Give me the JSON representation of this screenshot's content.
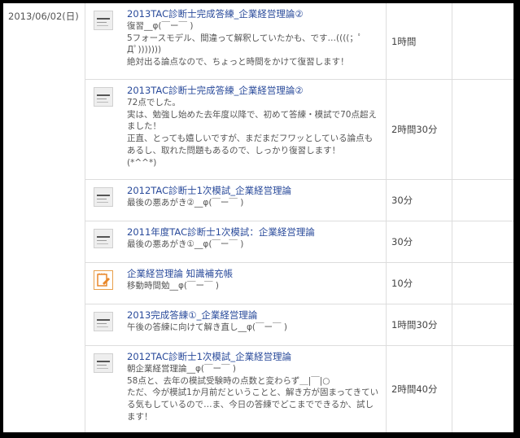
{
  "date": "2013/06/02(日)",
  "entries": [
    {
      "title": "2013TAC診断士完成答練_企業経営理論②",
      "description": "復習__φ(￣ー￣ )\n5フォースモデル、間違って解釈していたかも、です…((((；ﾟДﾟ)))))))\n絶対出る論点なので、ちょっと時間をかけて復習します！",
      "duration": "1時間",
      "icon": "document-thumbnail-icon"
    },
    {
      "title": "2013TAC診断士完成答練_企業経営理論②",
      "description": "72点でした。\n実は、勉強し始めた去年度以降で、初めて答練・模試で70点超えました！\n正直、とっても嬉しいですが、まだまだフワッとしている論点もあるし、取れた問題もあるので、しっかり復習します！\n(*^^*)",
      "duration": "2時間30分",
      "icon": "document-thumbnail-icon"
    },
    {
      "title": "2012TAC診断士1次模試_企業経営理論",
      "description": "最後の悪あがき②__φ(￣ー￣ )",
      "duration": "30分",
      "icon": "document-thumbnail-icon"
    },
    {
      "title": "2011年度TAC診断士1次模試：企業経営理論",
      "description": "最後の悪あがき①__φ(￣ー￣ )",
      "duration": "30分",
      "icon": "document-thumbnail-icon"
    },
    {
      "title": "企業経営理論 知識補充帳",
      "description": "移動時間勉__φ(￣ー￣ )",
      "duration": "10分",
      "icon": "notebook-pencil-icon"
    },
    {
      "title": "2013完成答練①_企業経営理論",
      "description": "午後の答練に向けて解き直し__φ(￣ー￣ )",
      "duration": "1時間30分",
      "icon": "document-thumbnail-icon"
    },
    {
      "title": "2012TAC診断士1次模試_企業経営理論",
      "description": "朝企業経営理論__φ(￣ー￣ )\n58点と、去年の模試受験時の点数と変わらず＿|￣|○\nただ、今が模試1か月前だということと、解き方が固まってきている気もしているので…ま、今日の答練でどこまでできるか、試します！",
      "duration": "2時間40分",
      "icon": "document-thumbnail-icon"
    }
  ]
}
